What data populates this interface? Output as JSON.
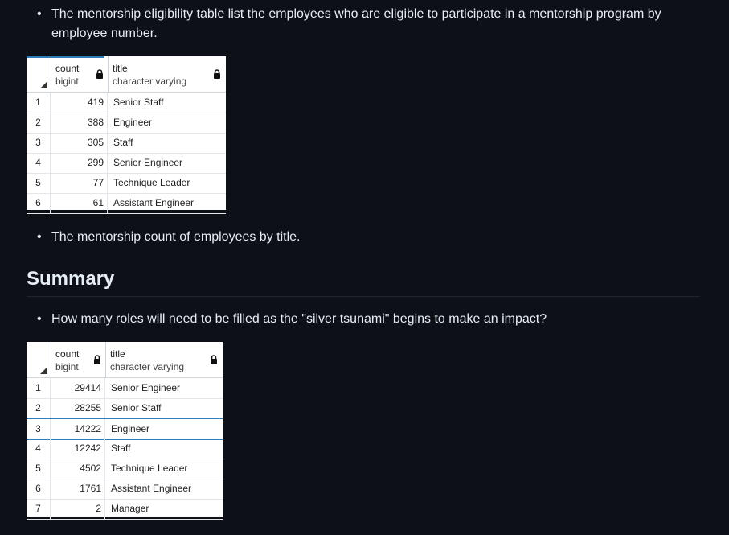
{
  "bullets": {
    "eligibility": "The mentorship eligibility table list the employees who are eligible to participate in a mentorship program by employee number.",
    "mentorship_count": "The mentorship count of employees by title.",
    "question": "How many roles will need to be filled as the \"silver tsunami\" begins to make an impact?"
  },
  "summary_heading": "Summary",
  "table1": {
    "columns": [
      {
        "name": "count",
        "type": "bigint"
      },
      {
        "name": "title",
        "type": "character varying"
      }
    ],
    "rows": [
      {
        "n": "1",
        "count": "419",
        "title": "Senior Staff"
      },
      {
        "n": "2",
        "count": "388",
        "title": "Engineer"
      },
      {
        "n": "3",
        "count": "305",
        "title": "Staff"
      },
      {
        "n": "4",
        "count": "299",
        "title": "Senior Engineer"
      },
      {
        "n": "5",
        "count": "77",
        "title": "Technique Leader"
      },
      {
        "n": "6",
        "count": "61",
        "title": "Assistant Engineer"
      }
    ]
  },
  "table2": {
    "columns": [
      {
        "name": "count",
        "type": "bigint"
      },
      {
        "name": "title",
        "type": "character varying"
      }
    ],
    "rows": [
      {
        "n": "1",
        "count": "29414",
        "title": "Senior Engineer"
      },
      {
        "n": "2",
        "count": "28255",
        "title": "Senior Staff"
      },
      {
        "n": "3",
        "count": "14222",
        "title": "Engineer"
      },
      {
        "n": "4",
        "count": "12242",
        "title": "Staff"
      },
      {
        "n": "5",
        "count": "4502",
        "title": "Technique Leader"
      },
      {
        "n": "6",
        "count": "1761",
        "title": "Assistant Engineer"
      },
      {
        "n": "7",
        "count": "2",
        "title": "Manager"
      }
    ],
    "selected_row": "3"
  },
  "icons": {
    "lock": "lock-icon",
    "sort": "sort-corner-icon"
  },
  "colors": {
    "background": "#0d1117",
    "text": "#e6edf3",
    "selection": "#2e7dba"
  }
}
